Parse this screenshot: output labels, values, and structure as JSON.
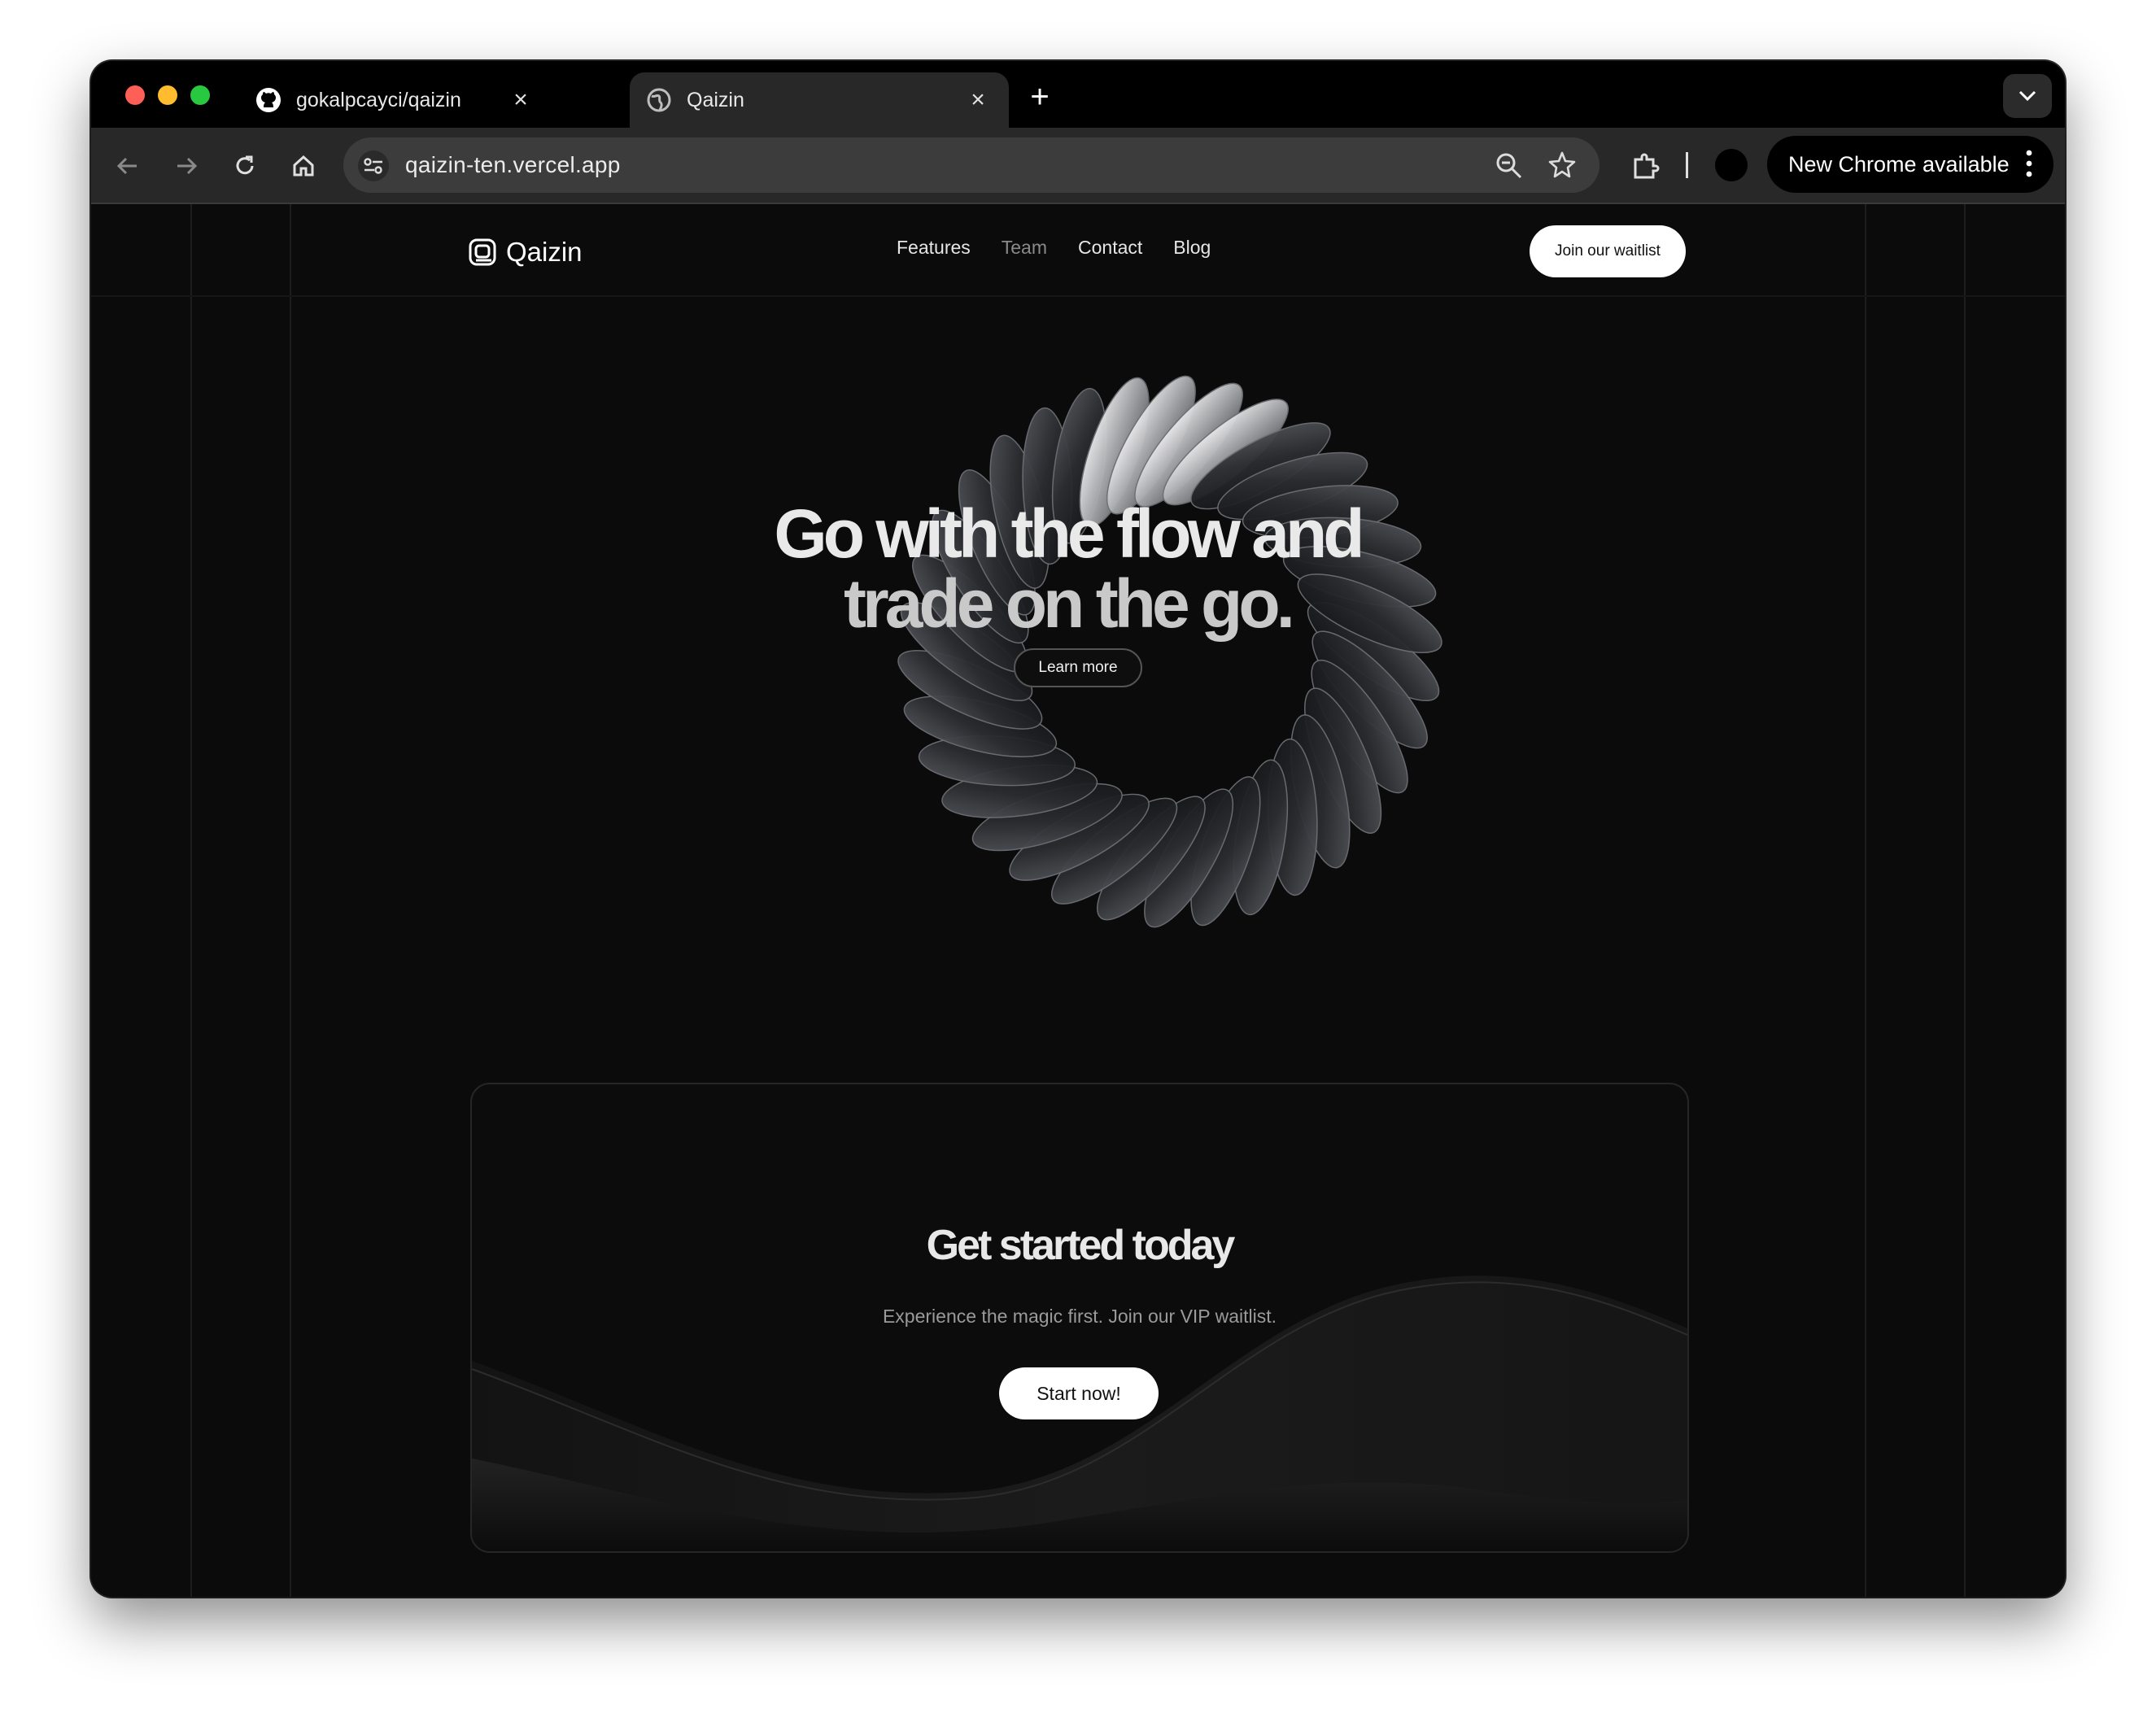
{
  "browser": {
    "tabs": [
      {
        "label": "gokalpcayci/qaizin",
        "icon": "github-icon"
      },
      {
        "label": "Qaizin",
        "icon": "globe-icon"
      }
    ],
    "url": "qaizin-ten.vercel.app",
    "update_label": "New Chrome available"
  },
  "site": {
    "logo": "Qaizin",
    "nav": [
      "Features",
      "Team",
      "Contact",
      "Blog"
    ],
    "waitlist_button": "Join our waitlist"
  },
  "hero": {
    "title_line1": "Go with the flow and",
    "title_line2": "trade on the go.",
    "learn_more": "Learn more"
  },
  "cta": {
    "title": "Get started today",
    "subtitle": "Experience the magic first. Join our VIP waitlist.",
    "button": "Start now!"
  },
  "colors": {
    "page_bg": "#0b0b0b",
    "card_border": "#262626",
    "button_bg": "#ffffff"
  }
}
